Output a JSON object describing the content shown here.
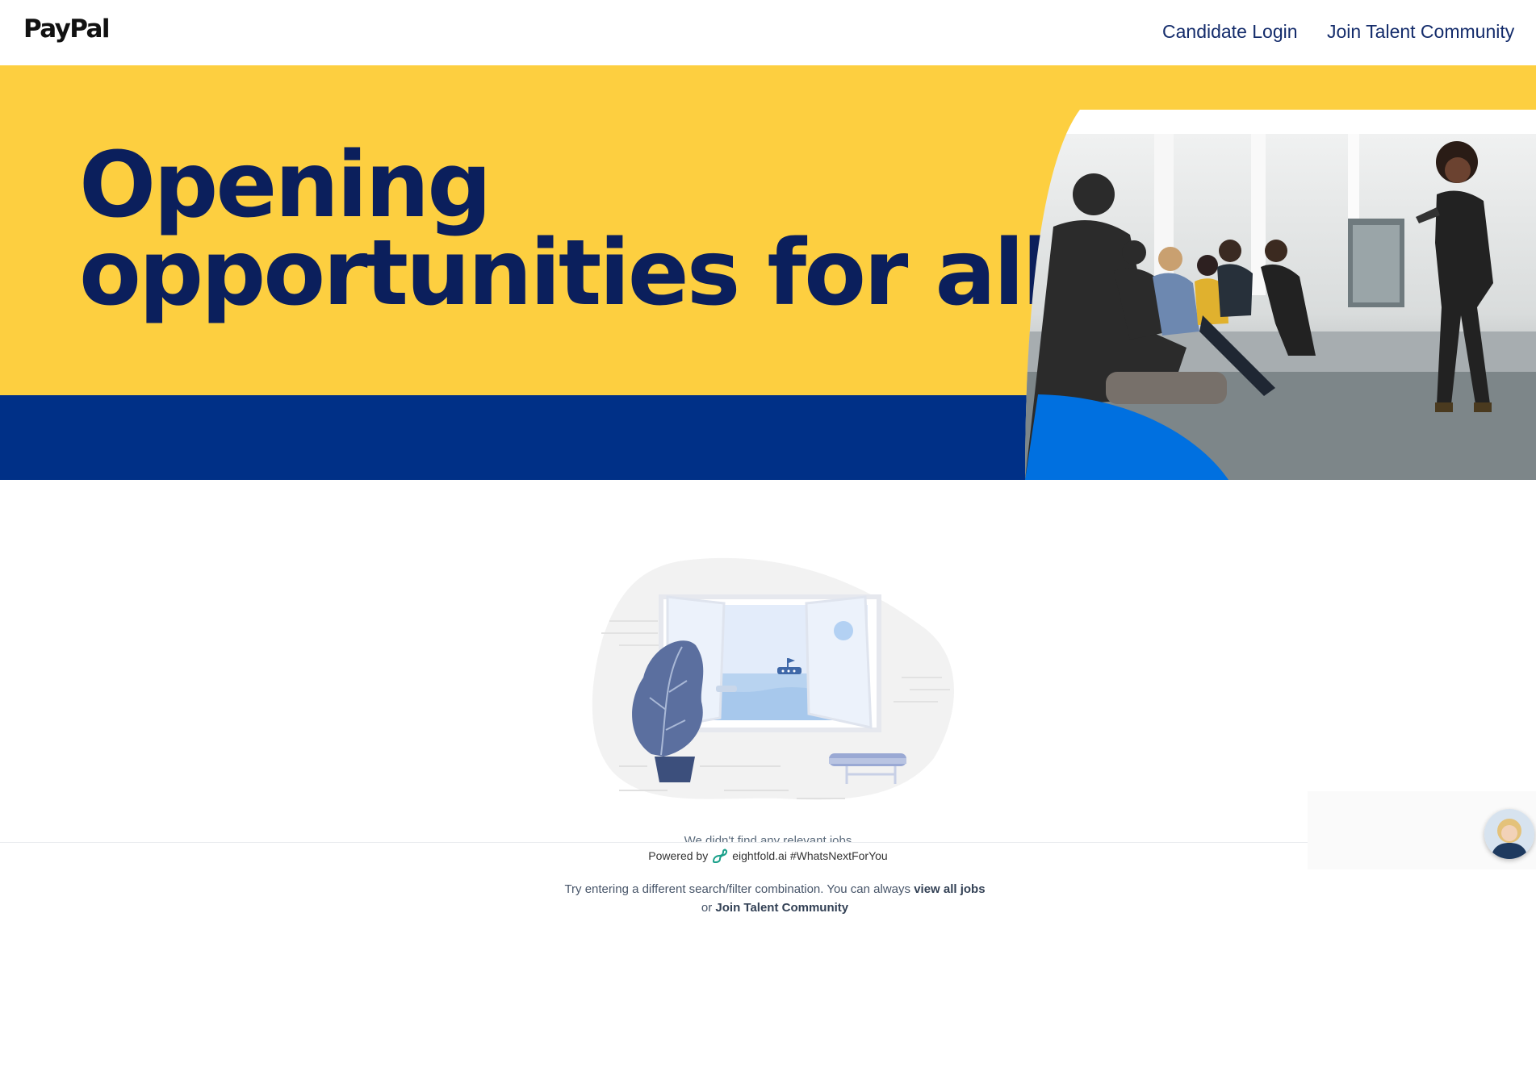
{
  "header": {
    "logo_text": "PayPal",
    "nav": {
      "candidate_login": "Candidate Login",
      "join_talent_community": "Join Talent Community"
    }
  },
  "hero": {
    "title_line1": "Opening",
    "title_line2": "opportunities for all.",
    "colors": {
      "yellow": "#fdcf40",
      "navy": "#003087",
      "blue": "#0070e0",
      "title": "#0b1f5c"
    }
  },
  "empty_state": {
    "cut_message": "We didn't find any relevant jobs",
    "hint_prefix": "Try entering a different search/filter combination. You can always ",
    "view_all_jobs": "view all jobs",
    "hint_or": "or ",
    "join_talent_community": "Join Talent Community"
  },
  "footer": {
    "powered_by": "Powered by",
    "brand": "eightfold.ai",
    "hashtag": "#WhatsNextForYou"
  },
  "icons": {
    "eightfold_logo": "eightfold-logo-icon",
    "assistant_avatar": "assistant-avatar"
  }
}
